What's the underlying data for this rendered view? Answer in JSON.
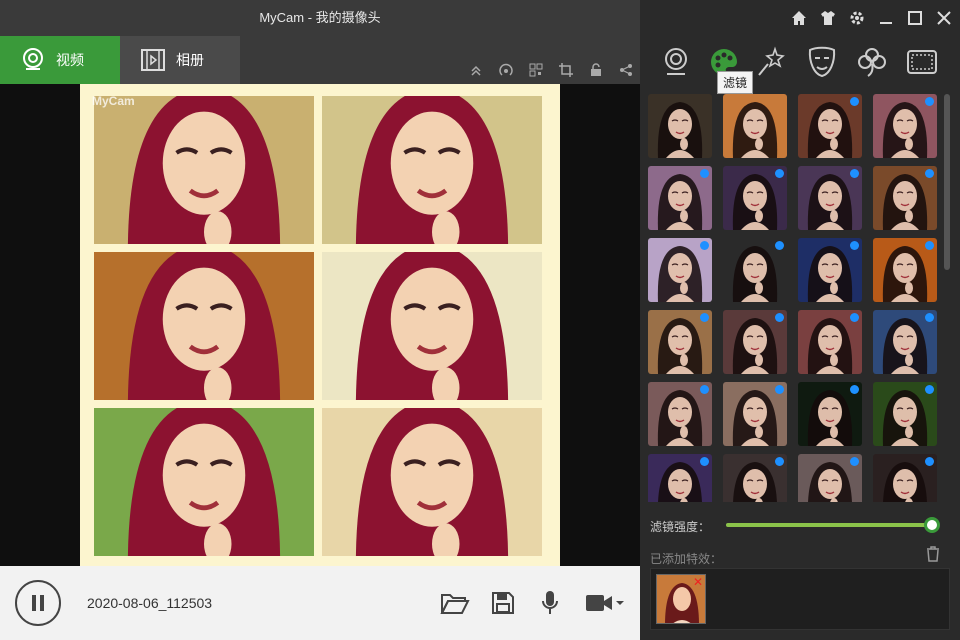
{
  "window": {
    "title": "MyCam - 我的摄像头"
  },
  "tabs": [
    {
      "label": "视频",
      "icon": "webcam-icon",
      "active": true
    },
    {
      "label": "相册",
      "icon": "film-icon",
      "active": false
    }
  ],
  "toolbar": {
    "icons": [
      "collapse-up-icon",
      "broadcast-icon",
      "qr-code-icon",
      "crop-icon",
      "lock-icon",
      "share-icon"
    ]
  },
  "preview": {
    "watermark": "MyCam"
  },
  "bottom": {
    "recording_name": "2020-08-06_112503"
  },
  "effects": {
    "tabs": [
      "webcam-icon",
      "palette-icon",
      "magic-wand-icon",
      "mask-icon",
      "clover-icon",
      "frame-icon"
    ],
    "active_tab": "palette-icon",
    "tooltip": "滤镜"
  },
  "filters": {
    "colors": [
      [
        "#3a3127",
        "#c87a3a",
        "#6b3a2a",
        "#8f5560"
      ],
      [
        "#8d6a8b",
        "#3b2a4a",
        "#4a3656",
        "#7a4a2a"
      ],
      [
        "#b8a3c7",
        "#2a2a2a",
        "#1e2e66",
        "#b85a18"
      ],
      [
        "#9a7048",
        "#5a3a3a",
        "#7a4040",
        "#2e4a7a"
      ],
      [
        "#7a5a5a",
        "#8a6e60",
        "#0f1a10",
        "#2a4a1a"
      ],
      [
        "#3a2a5a",
        "#3a3030",
        "#6a5a5a",
        "#2a2020"
      ]
    ],
    "dots": [
      [
        false,
        false,
        true,
        true
      ],
      [
        true,
        true,
        true,
        true
      ],
      [
        true,
        true,
        true,
        true
      ],
      [
        true,
        true,
        true,
        true
      ],
      [
        true,
        true,
        true,
        true
      ],
      [
        true,
        true,
        true,
        true
      ]
    ]
  },
  "strength": {
    "label": "滤镜强度：",
    "value": 1.0
  },
  "added": {
    "label": "已添加特效："
  },
  "colors": {
    "accent": "#3a9a3a",
    "slider": "#8bc34a",
    "dot": "#1e90ff"
  }
}
